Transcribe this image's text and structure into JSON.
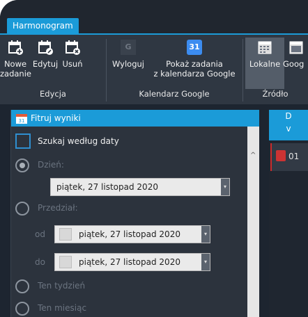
{
  "tab": {
    "label": "Harmonogram"
  },
  "ribbon": {
    "buttons": [
      {
        "line1": "Nowe",
        "line2": "zadanie"
      },
      {
        "line1": "Edytuj",
        "line2": ""
      },
      {
        "line1": "Usuń",
        "line2": ""
      },
      {
        "line1": "Wyloguj",
        "line2": ""
      },
      {
        "line1": "Pokaż zadania",
        "line2": "z kalendarza Google"
      },
      {
        "line1": "Lokalne",
        "line2": ""
      },
      {
        "line1": "Goog",
        "line2": ""
      }
    ],
    "groups": {
      "edit": "Edycja",
      "google": "Kalendarz Google",
      "source": "Źródło"
    },
    "calendar_badge": "31",
    "google_letter": "G"
  },
  "filter": {
    "title": "Fitruj wyniki",
    "search_by_date": "Szukaj według daty",
    "day_label": "Dzień:",
    "day_value": "piątek, 27 listopad  2020",
    "range_label": "Przedział:",
    "from_label": "od",
    "from_value": "piątek, 27 listopad  2020",
    "to_label": "do",
    "to_value": "piątek, 27 listopad  2020",
    "this_week": "Ten tydzień",
    "this_month": "Ten miesiąc"
  },
  "right_panel": {
    "header_line1": "D",
    "header_line2": "v",
    "item_text": "01"
  },
  "colors": {
    "accent": "#1b9bd8",
    "background": "#1d2530",
    "ribbon": "#2f3742"
  }
}
